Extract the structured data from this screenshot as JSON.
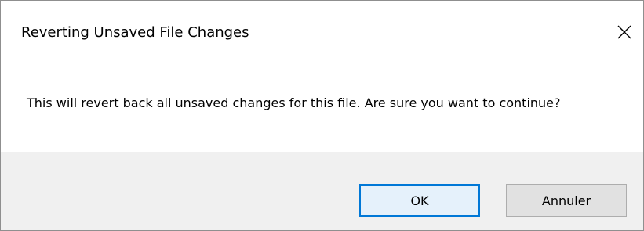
{
  "dialog": {
    "title": "Reverting Unsaved File Changes",
    "message": "This will revert back all unsaved changes for this file. Are sure you want to continue?",
    "close_icon": "close-icon"
  },
  "buttons": {
    "ok_label": "OK",
    "cancel_label": "Annuler"
  },
  "colors": {
    "default_button_border": "#0078d7",
    "default_button_fill": "#e5f1fb",
    "footer_background": "#f0f0f0"
  }
}
